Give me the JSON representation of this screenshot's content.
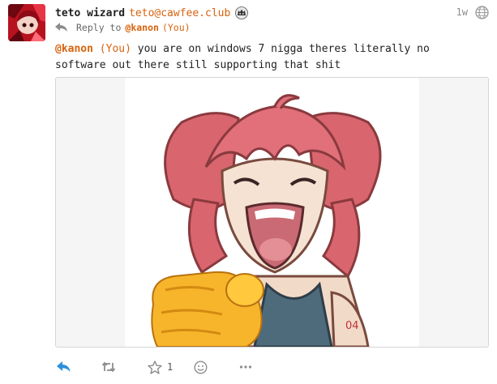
{
  "status": {
    "author": {
      "display_name": "teto wizard",
      "acct": "teto@cawfee.club",
      "avatar_icon": "avatar-image",
      "bot_badge_icon": "bot-badge-icon"
    },
    "relative_time": "1w",
    "visibility_icon": "globe-icon",
    "reply_to": {
      "prefix": "Reply to",
      "mention": "@kanon",
      "you_tag": "(You)"
    },
    "content": {
      "mention": "@kanon",
      "you_tag": "(You)",
      "text": " you are on windows 7 nigga theres literally no software out there still supporting that shit"
    },
    "attachment": {
      "type": "image",
      "description_icon": "pointing-teto-image"
    },
    "actions": {
      "reply_icon": "reply-icon",
      "boost_icon": "boost-icon",
      "favourite_icon": "star-icon",
      "favourite_count": "1",
      "react_icon": "emoji-icon",
      "more_icon": "more-icon"
    }
  },
  "colors": {
    "accent": "#d8630e",
    "reply_action": "#2b90d9",
    "muted": "#8c8c8c"
  }
}
